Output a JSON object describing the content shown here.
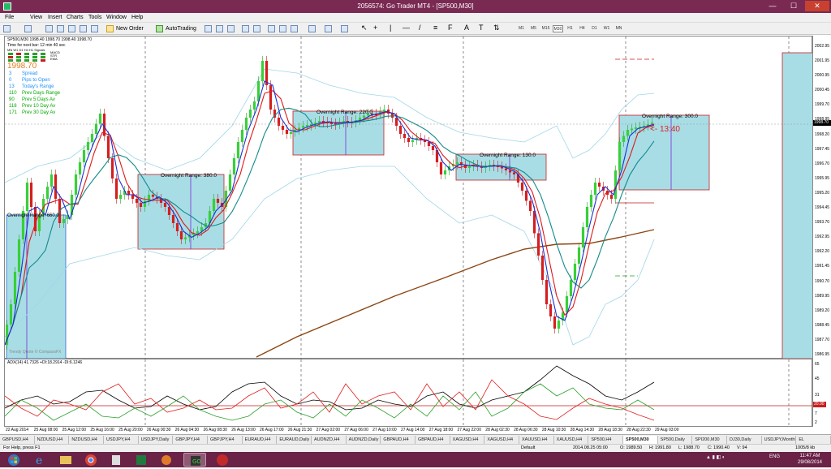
{
  "window": {
    "title": "2056574: Go Trader MT4 - [SP500,M30]",
    "min_label": "—",
    "max_label": "☐",
    "close_label": "✕"
  },
  "menu": [
    "File",
    "View",
    "Insert",
    "Charts",
    "Tools",
    "Window",
    "Help"
  ],
  "toolbar": {
    "new_order": "New Order",
    "autotrading": "AutoTrading",
    "timeframes": [
      "M1",
      "M5",
      "M15",
      "M30",
      "H1",
      "H4",
      "D1",
      "W1",
      "MN"
    ],
    "active_timeframe": "M30"
  },
  "chart": {
    "header": "SP500,M30  1998.40 1998.70 1998.40 1998.70",
    "next_bar": "Time for next bar: 12 min 40 sec",
    "signals_header": [
      "MN",
      "W1",
      "D1",
      "H4",
      "H1",
      "Signals"
    ],
    "signals": [
      "MACD",
      "STR",
      "EMA"
    ],
    "big_price": "1998.70",
    "stats": [
      {
        "value": "3",
        "label": "Spread",
        "color": "#1e90ff"
      },
      {
        "value": "0",
        "label": "Pips to Open",
        "color": "#1e90ff"
      },
      {
        "value": "13",
        "label": "Today's Range",
        "color": "#1e90ff"
      },
      {
        "value": "110",
        "label": "Prev Days Range",
        "color": "#00aa00"
      },
      {
        "value": "90",
        "label": "Prev 5 Days Av",
        "color": "#00aa00"
      },
      {
        "value": "118",
        "label": "Prev 10 Day Av",
        "color": "#00aa00"
      },
      {
        "value": "171",
        "label": "Prev 30 Day Av",
        "color": "#00aa00"
      }
    ],
    "watermark": "Trendy Quote © CompassFX",
    "countdown": "<- 13:40",
    "boxes": [
      {
        "label": "Overnight Range: 660.0"
      },
      {
        "label": "Overnight Range: 380.0"
      },
      {
        "label": "Overnight Range: 220.0"
      },
      {
        "label": "Overnight Range: 130.0"
      },
      {
        "label": "Overnight Range: 300.0"
      }
    ],
    "price_labels": [
      "2002.95",
      "2001.95",
      "2000.95",
      "2000.45",
      "1999.70",
      "1998.95",
      "1998.20",
      "1997.45",
      "1996.70",
      "1995.95",
      "1995.20",
      "1994.45",
      "1993.70",
      "1992.95",
      "1992.20",
      "1991.45",
      "1990.70",
      "1989.95",
      "1989.20",
      "1988.45",
      "1987.70",
      "1986.95"
    ],
    "current_price": "1998.70",
    "time_labels": [
      "22 Aug 2014",
      "25 Aug 08:00",
      "25 Aug 12:00",
      "25 Aug 16:00",
      "25 Aug 20:00",
      "26 Aug 00:30",
      "26 Aug 04:30",
      "26 Aug 08:30",
      "26 Aug 13:00",
      "26 Aug 17:00",
      "26 Aug 21:30",
      "27 Aug 02:00",
      "27 Aug 06:00",
      "27 Aug 10:00",
      "27 Aug 14:00",
      "27 Aug 18:00",
      "27 Aug 22:00",
      "28 Aug 02:30",
      "28 Aug 06:30",
      "28 Aug 10:30",
      "28 Aug 14:30",
      "28 Aug 18:30",
      "28 Aug 22:30",
      "29 Aug 03:00"
    ]
  },
  "indicator": {
    "title": "ADX(14) 41.7326 +DI:18.2914 -DI:6.1246",
    "axis": [
      "65",
      "45",
      "31",
      "20.00",
      "7",
      "2"
    ],
    "level_label": "20.00"
  },
  "tabs": [
    "GBPUSD,H4",
    "NZDUSD,H4",
    "NZDUSD,H4",
    "USDJPY,H4",
    "USDJPY,Daily",
    "GBPJPY,H4",
    "GBPJPY,H4",
    "EURAUD,H4",
    "EURAUD,Daily",
    "AUDNZD,H4",
    "AUDNZD,Daily",
    "GBPAUD,H4",
    "GBPAUD,H4",
    "XAGUSD,H4",
    "XAGUSD,H4",
    "XAUUSD,H4",
    "XAUUSD,H4",
    "SP500,H4",
    "SP500,M30",
    "SP500,Daily",
    "SPI200,M30",
    "DJ30,Daily",
    "USDJPY,Monthly",
    "EL"
  ],
  "active_tab": "SP500,M30",
  "status": {
    "help": "For Help, press F1",
    "profile": "Default",
    "datetime": "2014.08.25 05:00",
    "open": "O: 1989.50",
    "high": "H: 1991.80",
    "low": "L: 1988.70",
    "close": "C: 1990.40",
    "volume": "V: 94",
    "traffic": "1005/8 kb"
  },
  "taskbar": {
    "lang": "ENG",
    "time": "11:47 AM",
    "date": "29/08/2014"
  }
}
